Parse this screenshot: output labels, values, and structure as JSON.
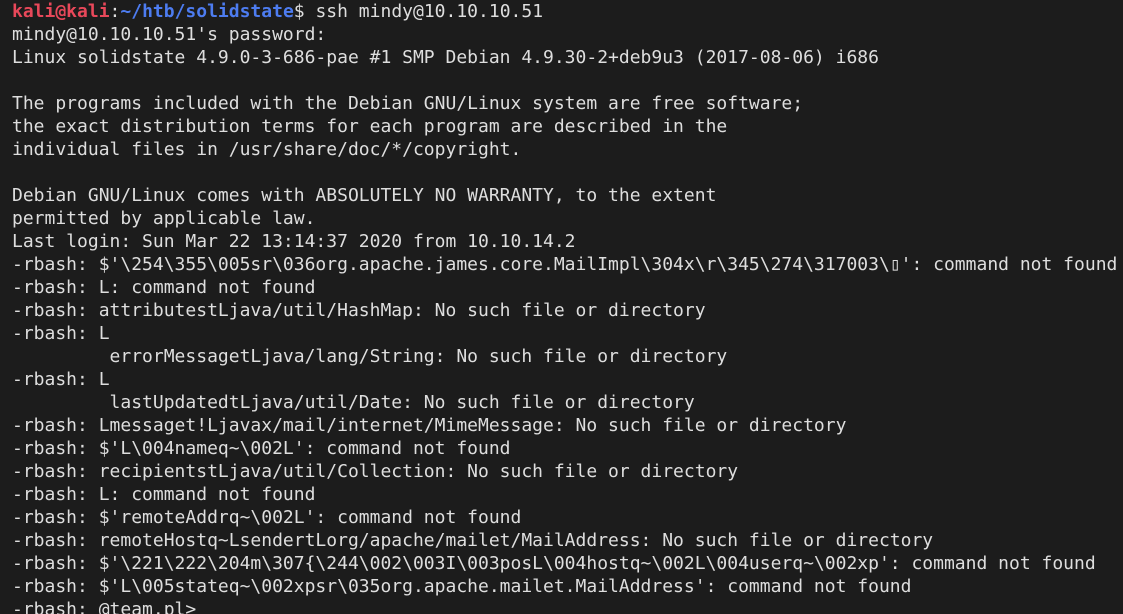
{
  "prompt": {
    "user_host": "kali@kali",
    "separator": ":",
    "path": "~/htb/solidstate",
    "symbol": "$",
    "command": " ssh mindy@10.10.10.51"
  },
  "colors": {
    "background": "#1c1c1c",
    "foreground": "#dedede",
    "user_host": "#e8485a",
    "path": "#4d7cf0"
  },
  "output_lines": [
    "mindy@10.10.10.51's password:",
    "Linux solidstate 4.9.0-3-686-pae #1 SMP Debian 4.9.30-2+deb9u3 (2017-08-06) i686",
    "",
    "The programs included with the Debian GNU/Linux system are free software;",
    "the exact distribution terms for each program are described in the",
    "individual files in /usr/share/doc/*/copyright.",
    "",
    "Debian GNU/Linux comes with ABSOLUTELY NO WARRANTY, to the extent",
    "permitted by applicable law.",
    "Last login: Sun Mar 22 13:14:37 2020 from 10.10.14.2",
    "-rbash: $'\\254\\355\\005sr\\036org.apache.james.core.MailImpl\\304x\\r\\345\\274\\317003\\▯': command not found",
    "-rbash: L: command not found",
    "-rbash: attributestLjava/util/HashMap: No such file or directory",
    "-rbash: L",
    "         errorMessagetLjava/lang/String: No such file or directory",
    "-rbash: L",
    "         lastUpdatedtLjava/util/Date: No such file or directory",
    "-rbash: Lmessaget!Ljavax/mail/internet/MimeMessage: No such file or directory",
    "-rbash: $'L\\004nameq~\\002L': command not found",
    "-rbash: recipientstLjava/util/Collection: No such file or directory",
    "-rbash: L: command not found",
    "-rbash: $'remoteAddrq~\\002L': command not found",
    "-rbash: remoteHostq~LsendertLorg/apache/mailet/MailAddress: No such file or directory",
    "-rbash: $'\\221\\222\\204m\\307{\\244\\002\\003I\\003posL\\004hostq~\\002L\\004userq~\\002xp': command not found",
    "-rbash: $'L\\005stateq~\\002xpsr\\035org.apache.mailet.MailAddress': command not found",
    "-rbash: @team.pl>"
  ]
}
